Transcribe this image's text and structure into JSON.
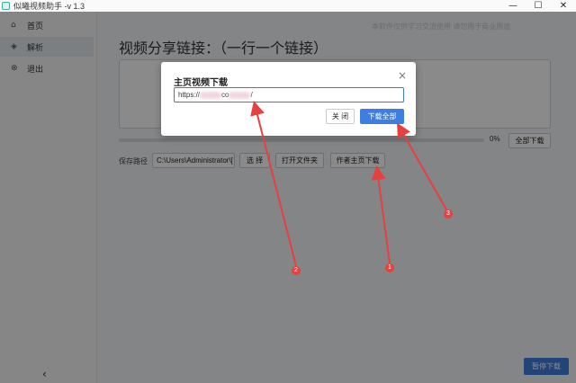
{
  "window": {
    "title": "似曦视频助手 -v 1.3",
    "buttons": [
      "—",
      "☐",
      "✕"
    ]
  },
  "sidebar": {
    "items": [
      {
        "label": "首页",
        "icon": "home-icon",
        "active": false
      },
      {
        "label": "解析",
        "icon": "layers-icon",
        "active": true
      },
      {
        "label": "退出",
        "icon": "exit-icon",
        "active": false
      }
    ],
    "collapse": "‹"
  },
  "main": {
    "notice": "本软件仅供学习交流使用 请勿用于商业用途",
    "heading": "视频分享链接：（一行一个链接）",
    "link_input_value": "",
    "progress": {
      "percent": 0,
      "label": "0%"
    },
    "download_all_label": "全部下载",
    "save_path_label": "保存路径",
    "save_path_value": "C:\\Users\\Administrator\\[",
    "choose_label": "选 择",
    "open_folder_label": "打开文件夹",
    "author_home_label": "作者主页下载",
    "pause_label": "暂停下载"
  },
  "modal": {
    "title": "主页视频下载",
    "close": "×",
    "url_prefix": "https://",
    "url_mid": "co",
    "url_suffix": "/",
    "cancel_label": "关 闭",
    "download_label": "下载全部"
  },
  "annotations": {
    "color": "#e83f3f",
    "badges": [
      "1",
      "2",
      "3"
    ]
  },
  "colors": {
    "accent": "#3d7fe0",
    "overlay": "rgba(0,0,0,0.46)"
  }
}
